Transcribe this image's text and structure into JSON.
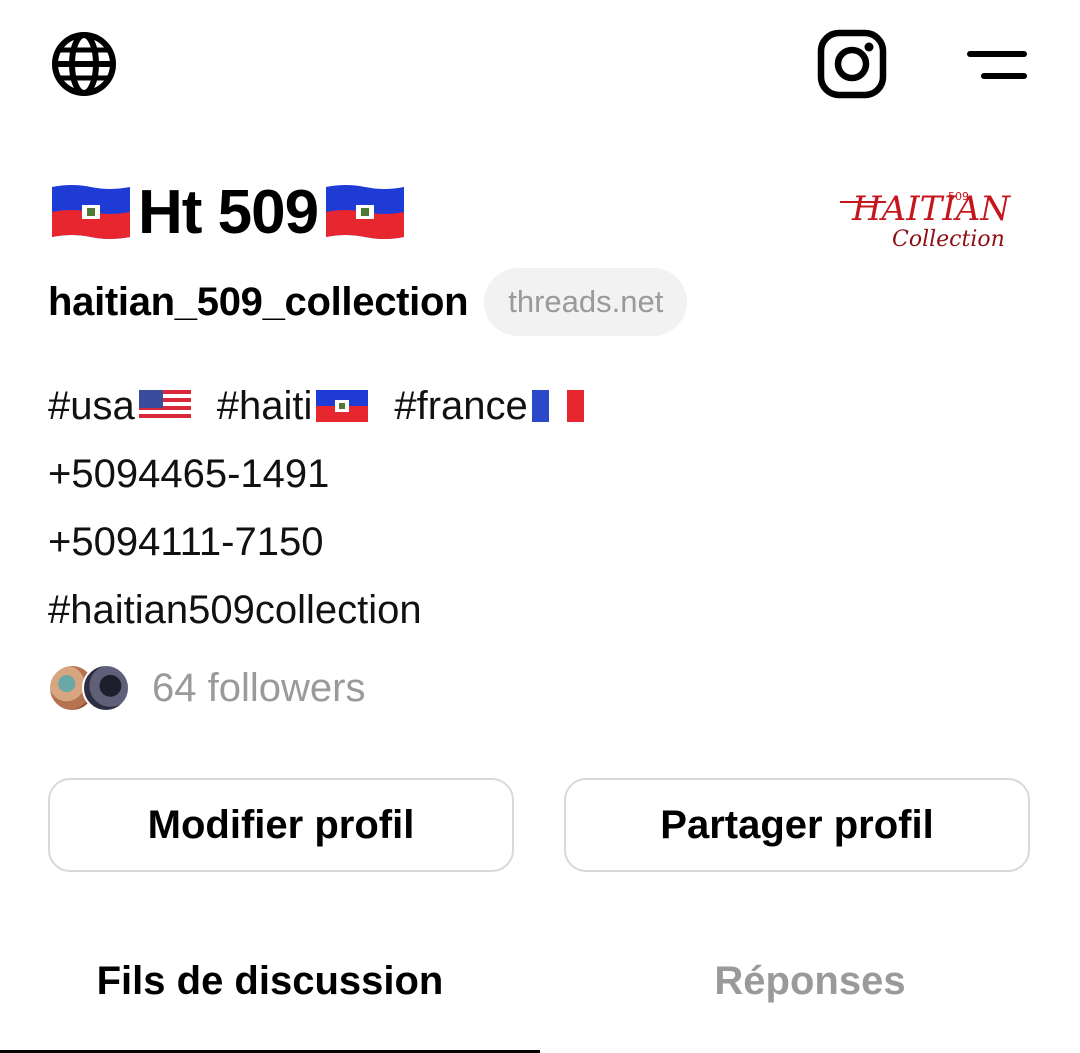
{
  "header": {
    "language_icon": "globe-icon",
    "instagram_icon": "instagram-icon",
    "menu_icon": "menu-icon"
  },
  "profile": {
    "display_name": "Ht 509",
    "name_flag": "haiti-flag",
    "username": "haitian_509_collection",
    "domain_badge": "threads.net",
    "logo_text_top": "HAITIAN",
    "logo_text_mark": "509",
    "logo_text_bottom": "Collection",
    "logo_color": "#c4161c"
  },
  "bio": {
    "tags": [
      {
        "text": "#usa",
        "flag": "usa-flag"
      },
      {
        "text": "#haiti",
        "flag": "haiti-flag"
      },
      {
        "text": "#france",
        "flag": "france-flag"
      }
    ],
    "phone_1": "+5094465-1491",
    "phone_2": "+5094111-7150",
    "hashtag": "#haitian509collection"
  },
  "followers": {
    "label": "64 followers"
  },
  "actions": {
    "edit_label": "Modifier profil",
    "share_label": "Partager profil"
  },
  "tabs": [
    {
      "label": "Fils de discussion",
      "active": true
    },
    {
      "label": "Réponses",
      "active": false
    }
  ],
  "colors": {
    "haiti_blue": "#1f3bd6",
    "haiti_red": "#e8262f",
    "muted_text": "#9a9a9a",
    "border": "#d9d9d9"
  }
}
